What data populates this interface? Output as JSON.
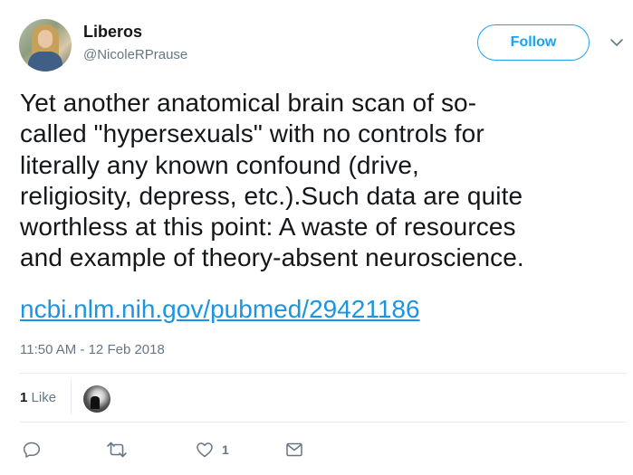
{
  "author": {
    "display_name": "Liberos",
    "screen_name": "@NicoleRPrause"
  },
  "follow_button": {
    "label": "Follow"
  },
  "tweet": {
    "lines": [
      "Yet another anatomical brain scan of so-",
      "called \"hypersexuals\" with no controls for",
      "literally any known confound (drive,",
      "religiosity, depress, etc.).Such data are quite",
      "worthless at this point: A waste of resources",
      "and example of theory-absent neuroscience."
    ],
    "link": "ncbi.nlm.nih.gov/pubmed/29421186",
    "timestamp": "11:50 AM - 12 Feb 2018"
  },
  "stats": {
    "likes_count": "1",
    "likes_label": "Like"
  },
  "actions": {
    "like_count": "1",
    "icons": [
      "reply-icon",
      "retweet-icon",
      "heart-icon",
      "envelope-icon"
    ]
  },
  "colors": {
    "accent": "#1da1f2",
    "link": "#1b95e0",
    "secondary_text": "#657786",
    "primary_text": "#14171a",
    "divider": "#e6ecf0"
  }
}
